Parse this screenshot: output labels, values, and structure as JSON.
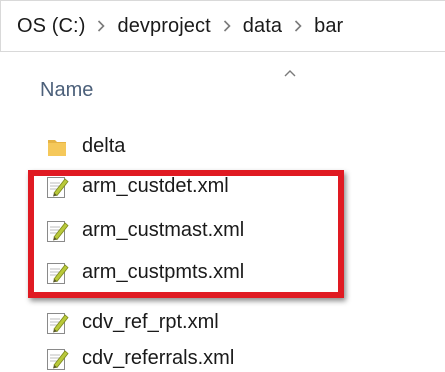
{
  "breadcrumb": {
    "items": [
      "OS (C:)",
      "devproject",
      "data",
      "bar"
    ],
    "separator_icon": "chevron-right-icon"
  },
  "column_header": {
    "label": "Name",
    "sort_icon": "sort-ascending-chevron-icon"
  },
  "files": [
    {
      "name": "delta",
      "icon": "folder-icon",
      "type": "folder"
    },
    {
      "name": "arm_custdet.xml",
      "icon": "xml-file-icon",
      "type": "file"
    },
    {
      "name": "arm_custmast.xml",
      "icon": "xml-file-icon",
      "type": "file"
    },
    {
      "name": "arm_custpmts.xml",
      "icon": "xml-file-icon",
      "type": "file"
    },
    {
      "name": "cdv_ref_rpt.xml",
      "icon": "xml-file-icon",
      "type": "file"
    },
    {
      "name": "cdv_referrals.xml",
      "icon": "xml-file-icon",
      "type": "file"
    }
  ],
  "highlight": {
    "color": "#e01a22",
    "covers": [
      "arm_custdet.xml",
      "arm_custmast.xml",
      "arm_custpmts.xml"
    ]
  },
  "colors": {
    "header_text": "#4c607a",
    "folder": "#f5c85a",
    "file_pen": "#b9c93a"
  }
}
